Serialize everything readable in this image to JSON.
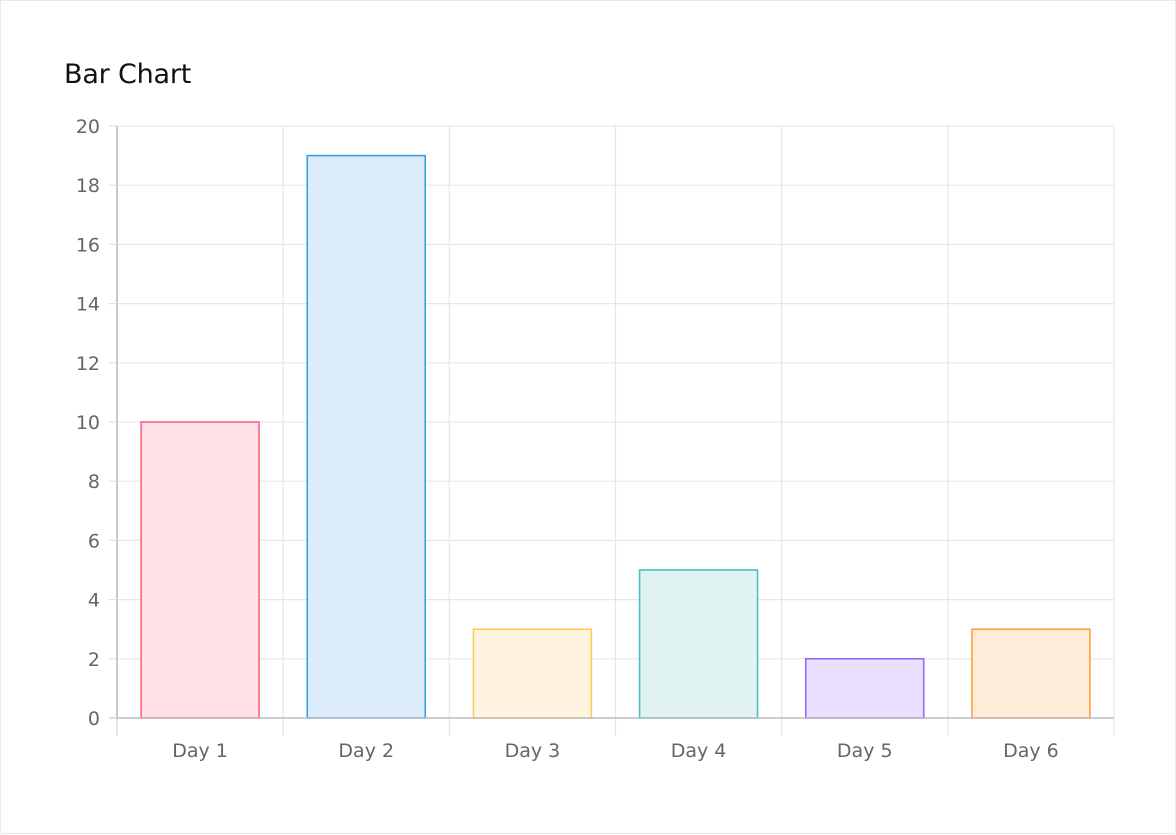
{
  "chart_data": {
    "type": "bar",
    "title": "Bar Chart",
    "xlabel": "",
    "ylabel": "",
    "categories": [
      "Day 1",
      "Day 2",
      "Day 3",
      "Day 4",
      "Day 5",
      "Day 6"
    ],
    "values": [
      10,
      19,
      3,
      5,
      2,
      3
    ],
    "ylim": [
      0,
      20
    ],
    "yticks": [
      0,
      2,
      4,
      6,
      8,
      10,
      12,
      14,
      16,
      18,
      20
    ],
    "grid": true,
    "legend": "none",
    "colors": {
      "fills": [
        "#ffe1e7",
        "#dcecfb",
        "#fff4e0",
        "#e0f3f2",
        "#ebe0ff",
        "#ffecd9"
      ],
      "borders": [
        "#ff6384",
        "#36a2eb",
        "#ffcd56",
        "#4bc0c0",
        "#9966ff",
        "#ff9f40"
      ]
    }
  }
}
